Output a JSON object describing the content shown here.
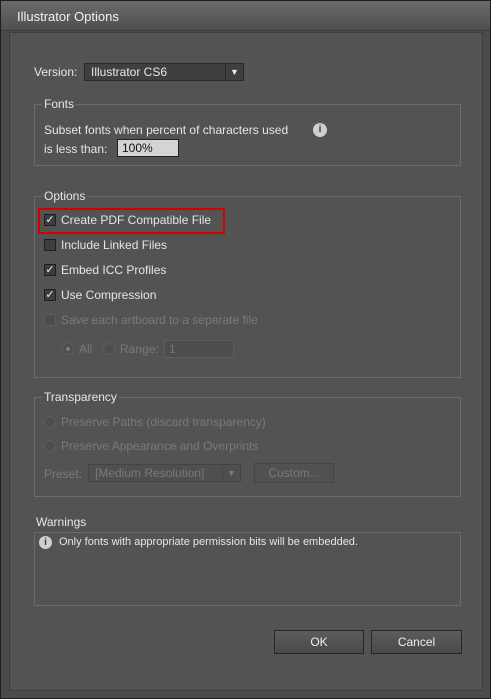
{
  "window": {
    "title": "Illustrator Options"
  },
  "version": {
    "label": "Version:",
    "value": "Illustrator CS6"
  },
  "fonts": {
    "legend": "Fonts",
    "line1": "Subset fonts when percent of characters used",
    "line2": "is less than:",
    "percent": "100%"
  },
  "options": {
    "legend": "Options",
    "create_pdf": {
      "label": "Create PDF Compatible File",
      "checked": true
    },
    "include_linked": {
      "label": "Include Linked Files",
      "checked": false
    },
    "embed_icc": {
      "label": "Embed ICC Profiles",
      "checked": true
    },
    "use_compression": {
      "label": "Use Compression",
      "checked": true
    },
    "save_artboards": {
      "label": "Save each artboard to a separate file",
      "checked": false
    },
    "all_label": "All",
    "range_label": "Range:",
    "range_value": "1"
  },
  "transparency": {
    "legend": "Transparency",
    "preserve_paths": "Preserve Paths (discard transparency)",
    "preserve_appearance": "Preserve Appearance and Overprints",
    "preset_label": "Preset:",
    "preset_value": "[Medium Resolution]",
    "custom_label": "Custom..."
  },
  "warnings": {
    "legend": "Warnings",
    "message": "Only fonts with appropriate permission bits will be embedded."
  },
  "buttons": {
    "ok": "OK",
    "cancel": "Cancel"
  },
  "colors": {
    "highlight": "#d40000",
    "background": "#535353"
  }
}
